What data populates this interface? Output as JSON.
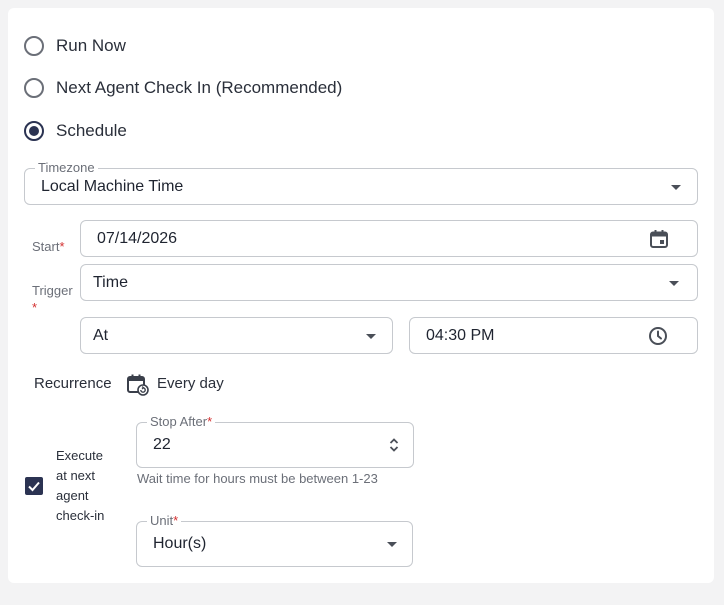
{
  "options": {
    "run_now": "Run Now",
    "next_agent_check_in": "Next Agent Check In (Recommended)",
    "schedule": "Schedule",
    "selected": "schedule"
  },
  "timezone": {
    "label": "Timezone",
    "value": "Local Machine Time"
  },
  "start": {
    "label": "Start",
    "required_mark": "*",
    "value": "07/14/2026"
  },
  "trigger": {
    "label": "Trigger",
    "required_mark": "*",
    "value": "Time"
  },
  "at": {
    "value": "At"
  },
  "time": {
    "value": "04:30 PM"
  },
  "recurrence": {
    "label": "Recurrence",
    "value": "Every day"
  },
  "execute": {
    "line1": "Execute",
    "line2": "at next",
    "line3": "agent",
    "line4": "check-in",
    "checked": true
  },
  "stop_after": {
    "label": "Stop After",
    "required_mark": "*",
    "value": "22",
    "helper": "Wait time for hours must be between 1-23"
  },
  "unit": {
    "label": "Unit",
    "required_mark": "*",
    "value": "Hour(s)"
  },
  "colors": {
    "accent": "#2b3352",
    "required": "#d32f2f",
    "border": "#c6c9ce"
  },
  "icons": {
    "date": "calendar-icon",
    "time": "clock-icon",
    "recurrence": "calendar-refresh-icon",
    "stepper": "up-down-chevron-icon"
  }
}
